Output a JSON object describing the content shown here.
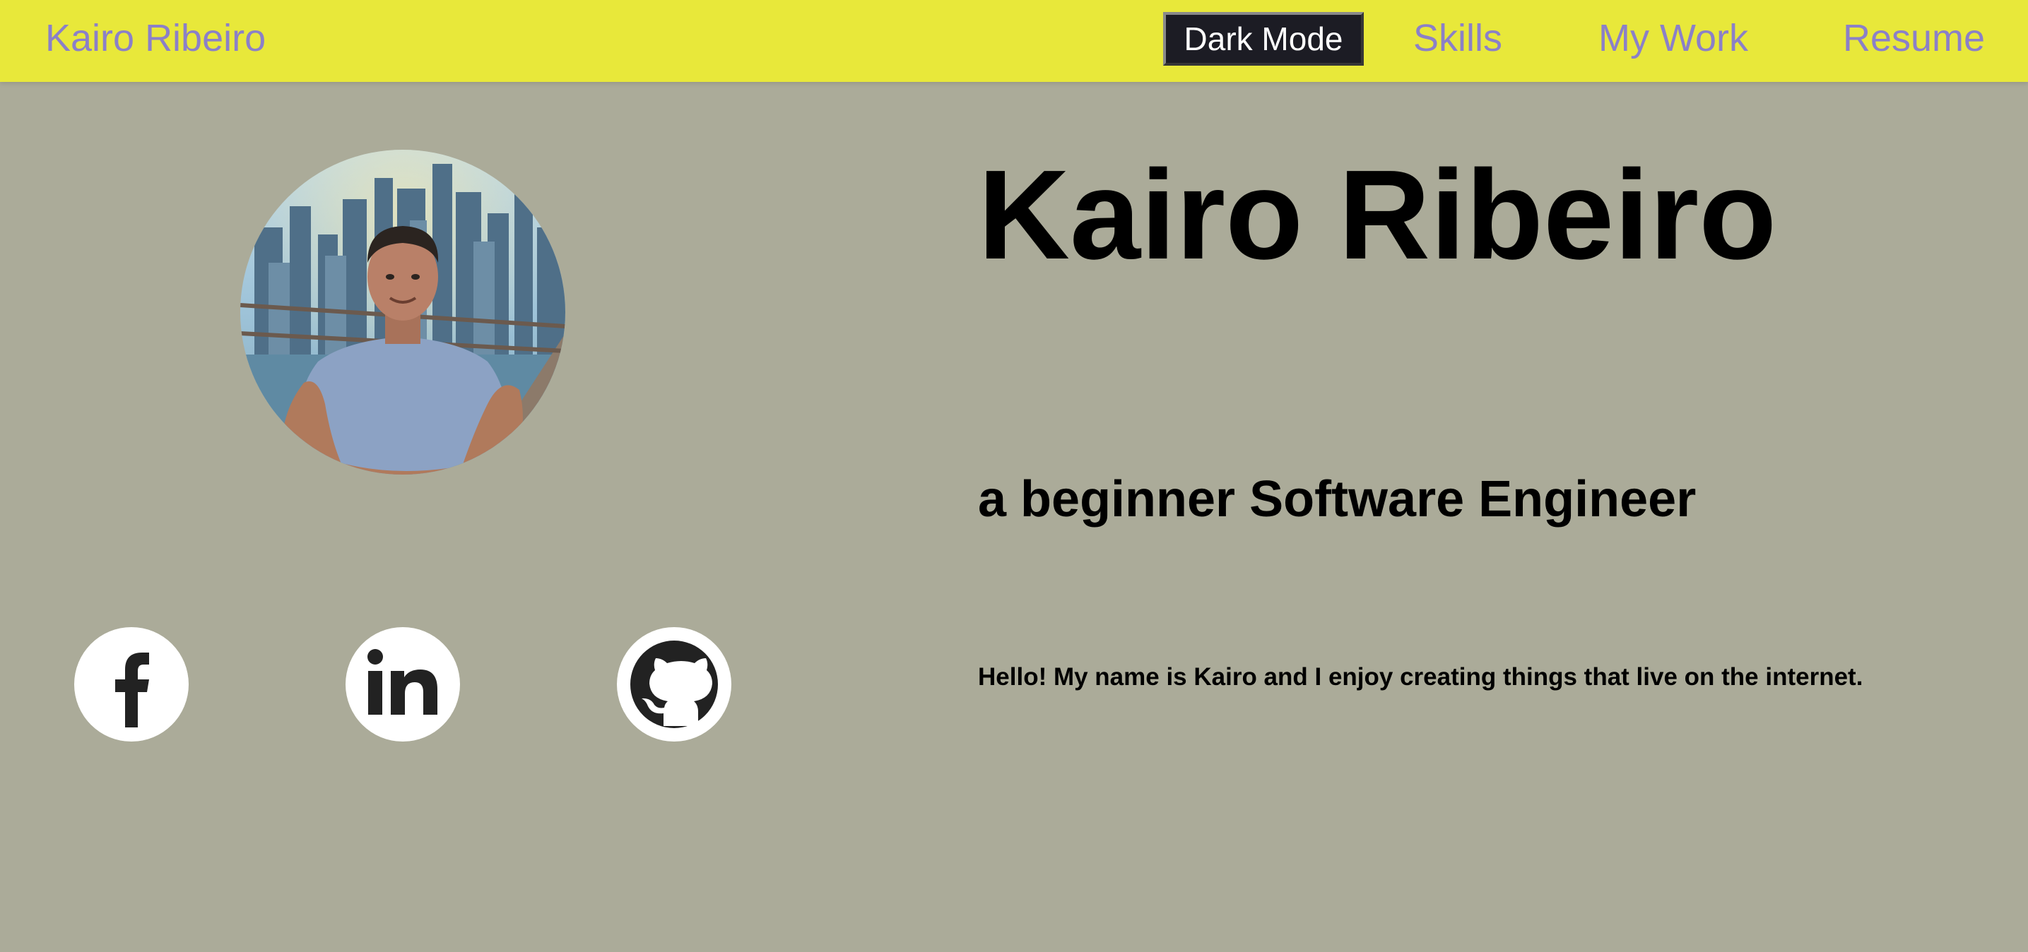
{
  "navbar": {
    "brand": "Kairo Ribeiro",
    "dark_mode_label": "Dark Mode",
    "links": [
      {
        "label": "Skills"
      },
      {
        "label": "My Work"
      },
      {
        "label": "Resume"
      }
    ]
  },
  "profile": {
    "avatar_alt": "profile-photo"
  },
  "social": [
    {
      "icon": "facebook-icon"
    },
    {
      "icon": "linkedin-icon"
    },
    {
      "icon": "github-icon"
    }
  ],
  "hero": {
    "name": "Kairo Ribeiro",
    "subtitle": "a beginner Software Engineer",
    "intro": "Hello! My name is Kairo and I enjoy creating things that live on the internet."
  },
  "colors": {
    "navbar_bg": "#e8e83a",
    "page_bg": "#abab99",
    "nav_link": "#8b80c8",
    "button_bg": "#1c1c24",
    "text": "#000000"
  }
}
